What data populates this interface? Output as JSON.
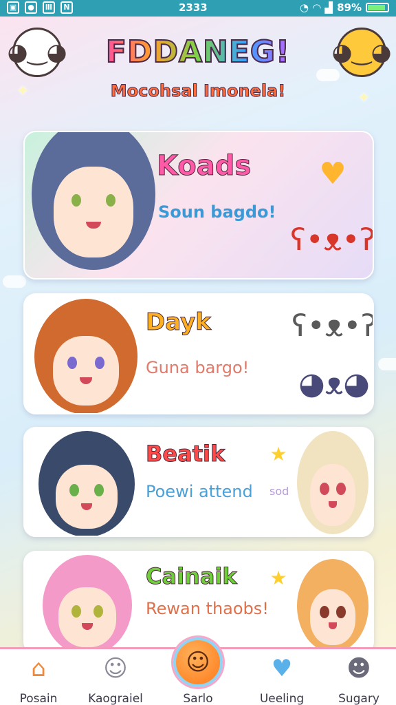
{
  "status_bar": {
    "time": "2333",
    "battery": "89%",
    "battery_level": 0.89,
    "left_icons": [
      "sim-icon",
      "circle-icon",
      "grid-icon",
      "nfc-icon"
    ],
    "right_icons": [
      "alarm-icon",
      "wifi-icon",
      "signal-icon",
      "battery-icon"
    ]
  },
  "header": {
    "title": "FDDANEG!",
    "subtitle": "Mocohsal Imonela!"
  },
  "cards": [
    {
      "title": "Koads",
      "subtitle": "Soun bagdo!",
      "title_color": "#ff5aa8",
      "subtitle_color": "#3a9ad8",
      "stickers": [
        "heart-sticker",
        "bear-sticker"
      ]
    },
    {
      "title": "Dayk",
      "subtitle": "Guna bargo!",
      "title_color": "#ffb020",
      "subtitle_color": "#e07a6a",
      "stickers": [
        "panda-sticker",
        "bunny-sticker"
      ]
    },
    {
      "title": "Beatik",
      "subtitle": "Poewi attend",
      "extra": "sod",
      "title_color": "#ff4a4a",
      "subtitle_color": "#4aa0d8",
      "stickers": [
        "star-sticker"
      ]
    },
    {
      "title": "Cainaik",
      "subtitle": "Rewan thaobs!",
      "title_color": "#6fcf3a",
      "subtitle_color": "#e0704a",
      "stickers": [
        "star-sticker"
      ]
    }
  ],
  "bottom_nav": {
    "items": [
      {
        "label": "Posain",
        "icon": "home-icon"
      },
      {
        "label": "Kaograiel",
        "icon": "ghost-icon"
      },
      {
        "label": "Sarlo",
        "icon": "smiley-icon"
      },
      {
        "label": "Ueeling",
        "icon": "heart-icon"
      },
      {
        "label": "Sugary",
        "icon": "profile-icon"
      }
    ]
  },
  "colors": {
    "status_bar": "#2f9fb4",
    "nav_accent": "#f39ab8",
    "center_button": "#ff7a1a"
  }
}
